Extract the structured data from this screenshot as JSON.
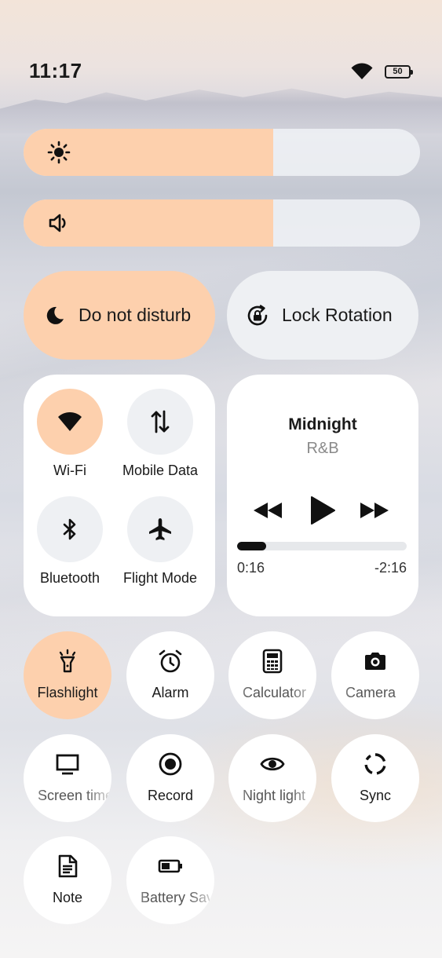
{
  "status_bar": {
    "time": "11:17",
    "battery": "50"
  },
  "sliders": {
    "brightness": {
      "level_percent": 63
    },
    "volume": {
      "level_percent": 63
    }
  },
  "toggles": {
    "dnd_label": "Do not disturb",
    "lock_rotation_label": "Lock Rotation"
  },
  "connectivity": {
    "wifi": "Wi-Fi",
    "mobile_data": "Mobile Data",
    "bluetooth": "Bluetooth",
    "flight_mode": "Flight Mode"
  },
  "media": {
    "title": "Midnight",
    "artist": "R&B",
    "elapsed": "0:16",
    "remaining": "-2:16",
    "progress_percent": 17
  },
  "tiles": {
    "flashlight": "Flashlight",
    "alarm": "Alarm",
    "calculator": "Calculator",
    "camera": "Camera",
    "screen_timeout": "Screen timeout",
    "record": "Record",
    "night_light": "Night light",
    "sync": "Sync",
    "note": "Note",
    "battery_saver": "Battery Saver"
  },
  "colors": {
    "accent": "#fdd0ad",
    "tile": "#ffffff",
    "inactive": "#eef0f3"
  },
  "icons": [
    "wifi-icon",
    "battery-icon",
    "sun-icon",
    "speaker-icon",
    "moon-icon",
    "lock-rotation-icon",
    "signal-arrows-icon",
    "bluetooth-icon",
    "airplane-icon",
    "rewind-icon",
    "play-icon",
    "fast-forward-icon",
    "flashlight-icon",
    "alarm-icon",
    "calculator-icon",
    "camera-icon",
    "monitor-icon",
    "record-icon",
    "eye-icon",
    "sync-icon",
    "note-icon",
    "battery-saver-icon"
  ]
}
